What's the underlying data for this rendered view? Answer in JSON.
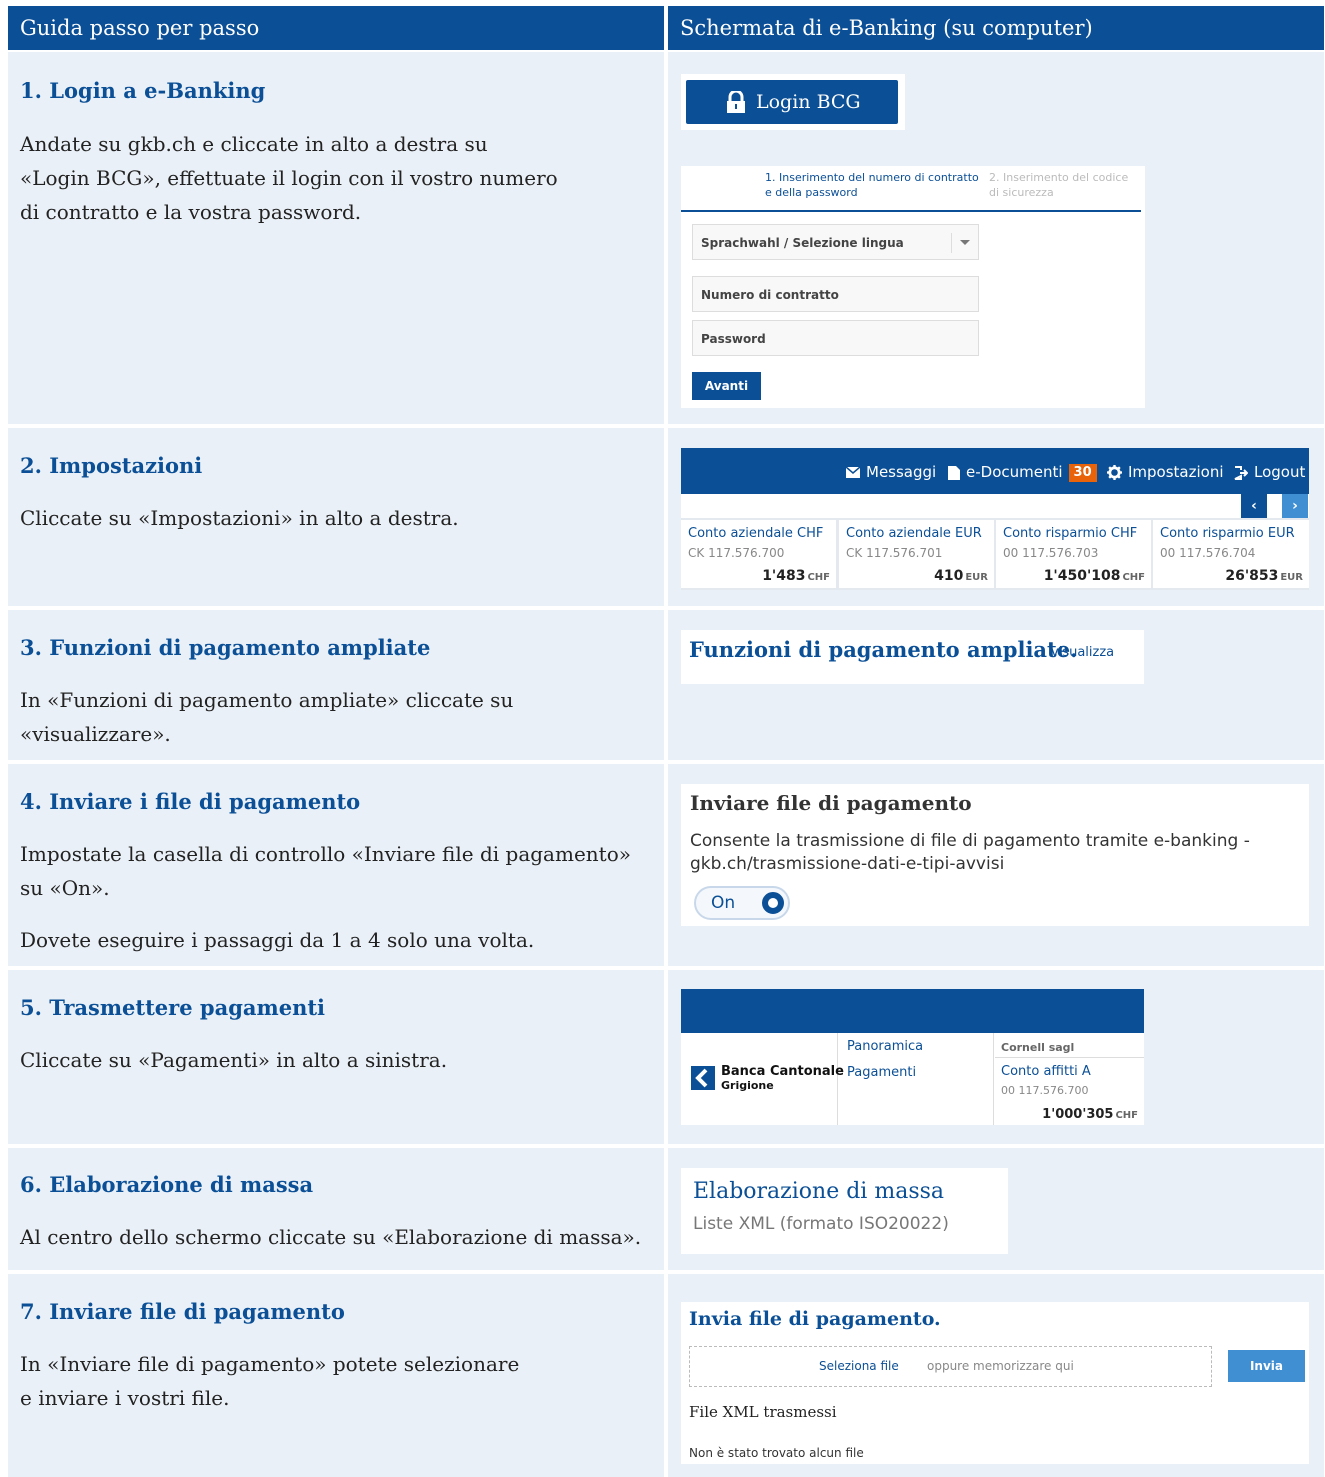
{
  "header": {
    "left": "Guida passo per passo",
    "right": "Schermata di e-Banking (su computer)"
  },
  "steps": [
    {
      "title": "1. Login a e-Banking",
      "lines": [
        "Andate su gkb.ch e cliccate in alto a destra su",
        "«Login BCG», effettuate il login con il vostro numero",
        "di contratto e la vostra password."
      ],
      "screen": {
        "login_button": "Login BCG",
        "tab1": "1. Inserimento del numero di contratto e della password",
        "tab2": "2. Inserimento del codice di sicurezza",
        "language_select": "Sprachwahl / Selezione lingua",
        "contract_placeholder": "Numero di contratto",
        "password_placeholder": "Password",
        "submit": "Avanti"
      }
    },
    {
      "title": "2. Impostazioni",
      "lines": [
        "Cliccate su «Impostazioni» in alto a destra."
      ],
      "screen": {
        "nav": {
          "messages": "Messaggi",
          "documents": "e-Documenti",
          "documents_count": "30",
          "settings": "Impostazioni",
          "logout": "Logout"
        },
        "prev": "‹",
        "next": "›",
        "accounts": [
          {
            "name": "Conto aziendale CHF",
            "number": "CK 117.576.700",
            "balance": "1'483",
            "currency": "CHF"
          },
          {
            "name": "Conto aziendale EUR",
            "number": "CK 117.576.701",
            "balance": "410",
            "currency": "EUR"
          },
          {
            "name": "Conto risparmio CHF",
            "number": "00 117.576.703",
            "balance": "1'450'108",
            "currency": "CHF"
          },
          {
            "name": "Conto risparmio EUR",
            "number": "00 117.576.704",
            "balance": "26'853",
            "currency": "EUR"
          }
        ]
      }
    },
    {
      "title": "3. Funzioni di pagamento ampliate",
      "lines": [
        "In «Funzioni di pagamento ampliate» cliccate su",
        "«visualizzare»."
      ],
      "screen": {
        "heading": "Funzioni di pagamento ampliate.",
        "link": "visualizza"
      }
    },
    {
      "title": "4. Inviare i file di pagamento",
      "lines": [
        "Impostate la casella di controllo «Inviare file di pagamento»",
        "su «On».",
        "Dovete eseguire i passaggi da 1 a 4 solo una volta."
      ],
      "screen": {
        "heading": "Inviare file di pagamento",
        "description": "Consente la trasmissione di file di pagamento tramite e-banking - gkb.ch/trasmissione-dati-e-tipi-avvisi",
        "toggle": "On"
      }
    },
    {
      "title": "5. Trasmettere pagamenti",
      "lines": [
        "Cliccate su «Pagamenti» in alto a sinistra."
      ],
      "screen": {
        "bank_name": "Banca Cantonale",
        "bank_region": "Grigione",
        "nav": [
          "Panoramica",
          "Pagamenti"
        ],
        "owner": "Cornell sagl",
        "account_name": "Conto affitti A",
        "account_number": "00 117.576.700",
        "balance": "1'000'305",
        "currency": "CHF"
      }
    },
    {
      "title": "6. Elaborazione di massa",
      "lines": [
        "Al centro dello schermo cliccate su «Elaborazione di massa»."
      ],
      "screen": {
        "heading": "Elaborazione di massa",
        "sub": "Liste XML (formato ISO20022)"
      }
    },
    {
      "title": "7. Inviare file di pagamento",
      "lines": [
        "In «Inviare file di pagamento» potete selezionare",
        "e inviare i vostri file."
      ],
      "screen": {
        "heading": "Invia file di pagamento.",
        "select": "Seleziona file",
        "or": "oppure memorizzare qui",
        "send": "Invia",
        "sub": "File XML trasmessi",
        "empty": "Non è stato trovato alcun file"
      }
    }
  ]
}
